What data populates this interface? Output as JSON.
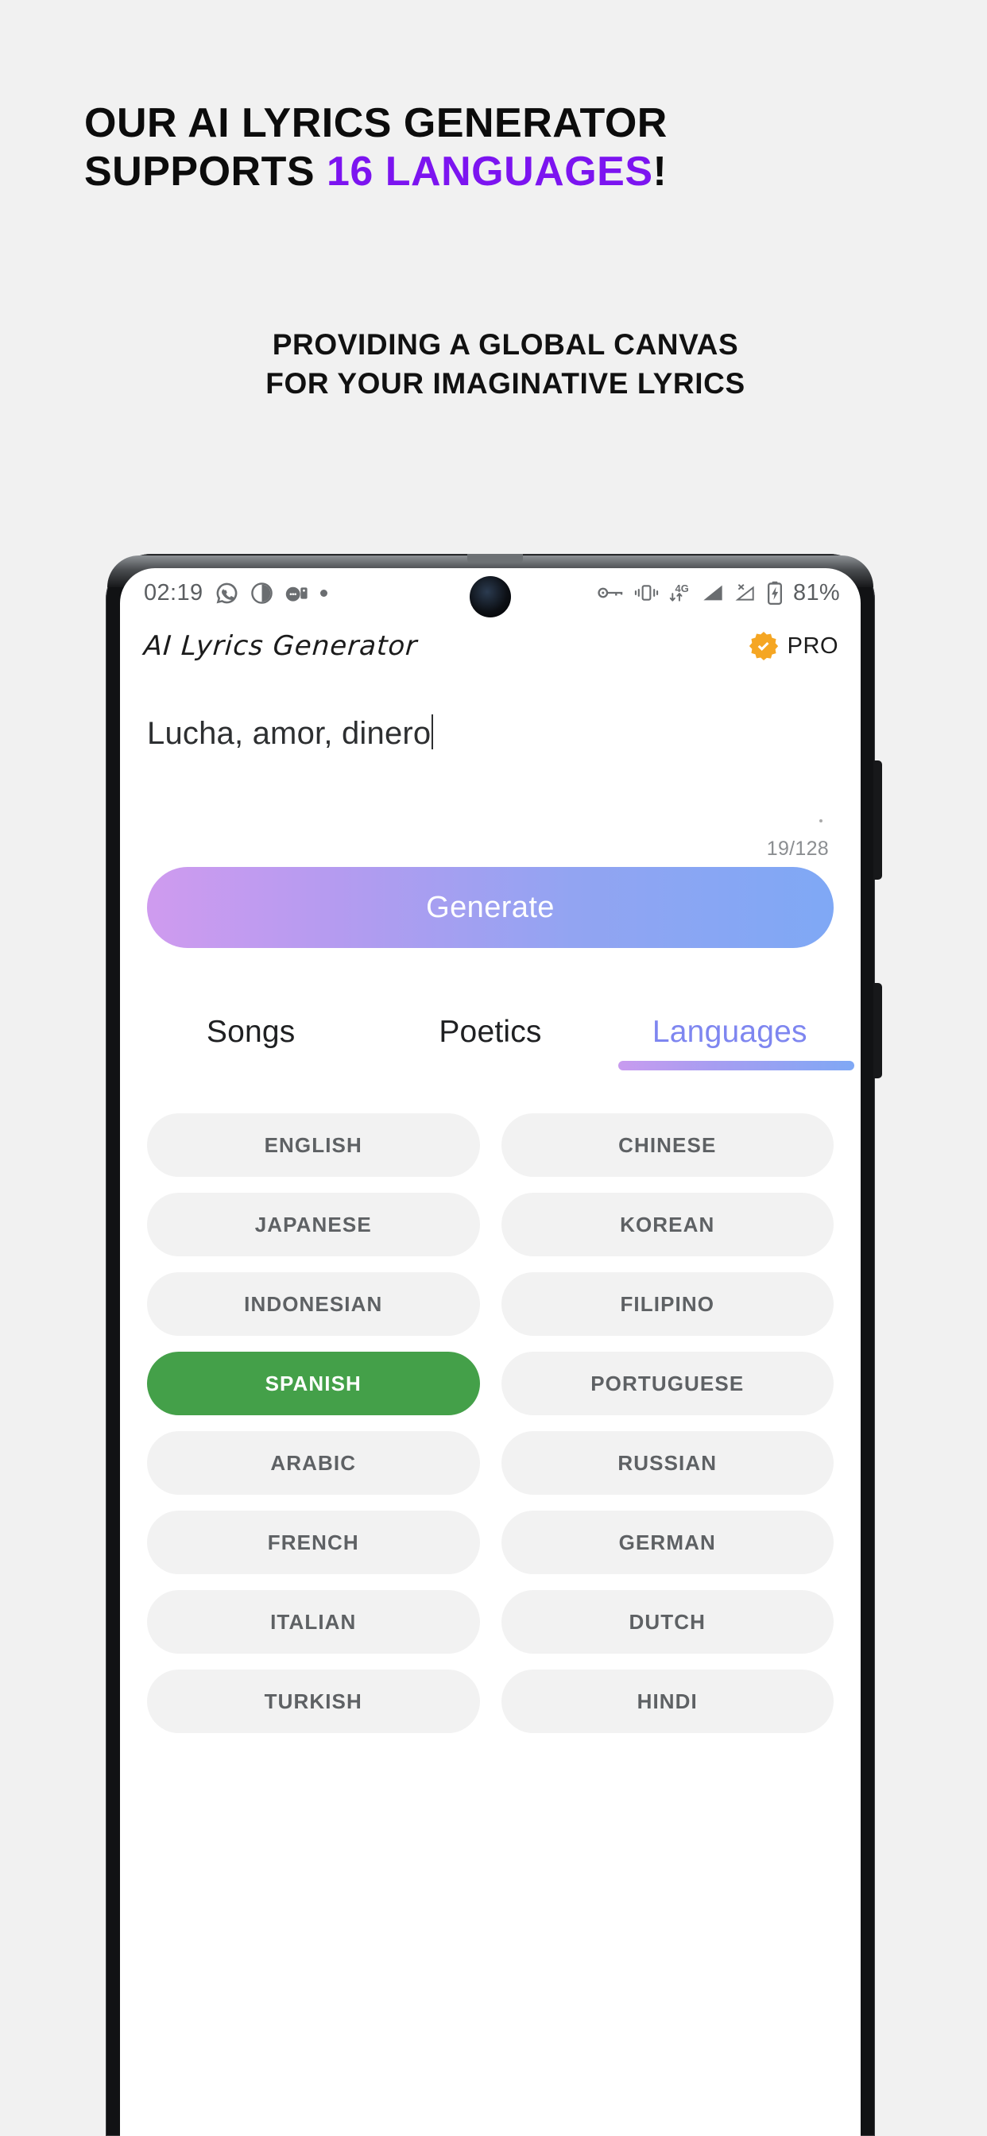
{
  "promo": {
    "headline_line1": "OUR AI LYRICS GENERATOR",
    "headline_line2_pre": "SUPPORTS ",
    "headline_accent": "16 LANGUAGES",
    "headline_line2_post": "!",
    "accent_color": "#7c14f0",
    "subheadline_line1": "PROVIDING A GLOBAL CANVAS",
    "subheadline_line2": "FOR YOUR IMAGINATIVE LYRICS"
  },
  "phone": {
    "status_bar": {
      "time": "02:19",
      "left_icons": [
        "whatsapp-icon",
        "contrast-icon",
        "messenger-icon",
        "dot-icon"
      ],
      "right_icons": [
        "vpn-key-icon",
        "vibrate-icon",
        "4g-data-icon",
        "signal-bars-icon",
        "no-signal-icon",
        "battery-charging-icon"
      ],
      "battery_percent": "81%"
    },
    "app": {
      "title": "AI Lyrics Generator",
      "pro_label": "PRO",
      "pro_badge_color": "#f5a623",
      "prompt": {
        "value": "Lucha, amor, dinero",
        "char_count": "19/128"
      },
      "generate_label": "Generate",
      "generate_gradient": [
        "#cf9bef",
        "#7fa8f5"
      ],
      "tabs": [
        {
          "label": "Songs",
          "active": false
        },
        {
          "label": "Poetics",
          "active": false
        },
        {
          "label": "Languages",
          "active": true
        }
      ],
      "active_tab_color": "#7e86f0",
      "selected_language": "SPANISH",
      "selected_color": "#44a049",
      "languages": [
        {
          "label": "ENGLISH",
          "selected": false
        },
        {
          "label": "CHINESE",
          "selected": false
        },
        {
          "label": "JAPANESE",
          "selected": false
        },
        {
          "label": "KOREAN",
          "selected": false
        },
        {
          "label": "INDONESIAN",
          "selected": false
        },
        {
          "label": "FILIPINO",
          "selected": false
        },
        {
          "label": "SPANISH",
          "selected": true
        },
        {
          "label": "PORTUGUESE",
          "selected": false
        },
        {
          "label": "ARABIC",
          "selected": false
        },
        {
          "label": "RUSSIAN",
          "selected": false
        },
        {
          "label": "FRENCH",
          "selected": false
        },
        {
          "label": "GERMAN",
          "selected": false
        },
        {
          "label": "ITALIAN",
          "selected": false
        },
        {
          "label": "DUTCH",
          "selected": false
        },
        {
          "label": "TURKISH",
          "selected": false
        },
        {
          "label": "HINDI",
          "selected": false
        }
      ]
    }
  }
}
